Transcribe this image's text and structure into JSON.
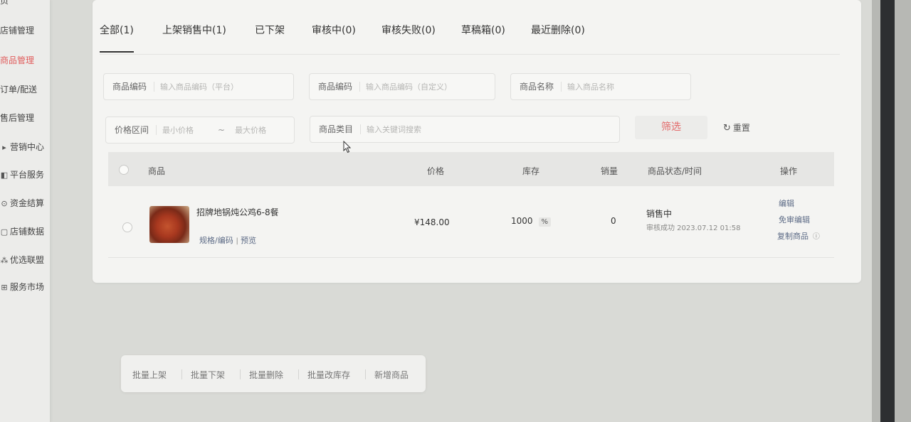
{
  "sidebar": {
    "items": [
      {
        "label": "页",
        "icon": "",
        "active": false
      },
      {
        "label": "店铺管理",
        "icon": "",
        "active": false
      },
      {
        "label": "商品管理",
        "icon": "",
        "active": true
      },
      {
        "label": "订单/配送",
        "icon": "",
        "active": false
      },
      {
        "label": "售后管理",
        "icon": "",
        "active": false
      },
      {
        "label": "营销中心",
        "icon": "megaphone-icon",
        "active": false
      },
      {
        "label": "平台服务",
        "icon": "platform-icon",
        "active": false
      },
      {
        "label": "资金结算",
        "icon": "coin-icon",
        "active": false
      },
      {
        "label": "店铺数据",
        "icon": "chart-icon",
        "active": false
      },
      {
        "label": "优选联盟",
        "icon": "network-icon",
        "active": false
      },
      {
        "label": "服务市场",
        "icon": "market-icon",
        "active": false
      }
    ]
  },
  "tabs": [
    {
      "label": "全部(1)",
      "active": true
    },
    {
      "label": "上架销售中(1)",
      "active": false
    },
    {
      "label": "已下架",
      "active": false
    },
    {
      "label": "审核中(0)",
      "active": false
    },
    {
      "label": "审核失败(0)",
      "active": false
    },
    {
      "label": "草稿箱(0)",
      "active": false
    },
    {
      "label": "最近删除(0)",
      "active": false
    }
  ],
  "filters": {
    "code_platform": {
      "label": "商品编码",
      "placeholder": "输入商品编码（平台）"
    },
    "code_custom": {
      "label": "商品编码",
      "placeholder": "输入商品编码（自定义）"
    },
    "name": {
      "label": "商品名称",
      "placeholder": "输入商品名称"
    },
    "price": {
      "label": "价格区间",
      "min_placeholder": "最小价格",
      "separator": "~",
      "max_placeholder": "最大价格"
    },
    "category": {
      "label": "商品类目",
      "placeholder": "输入关键词搜索"
    },
    "filter_button": "筛选",
    "reset_button": "重置"
  },
  "table": {
    "headers": {
      "product": "商品",
      "price": "价格",
      "stock": "库存",
      "sales": "销量",
      "status": "商品状态/时间",
      "actions": "操作"
    },
    "rows": [
      {
        "name": "招牌地锅炖公鸡6-8餐",
        "sub_link_1": "规格/编码",
        "sub_link_2": "预览",
        "price": "¥148.00",
        "stock": "1000",
        "stock_unit": "%",
        "sales": "0",
        "status": "销售中",
        "status_time": "审核成功 2023.07.12 01:58",
        "actions": [
          "编辑",
          "免审编辑",
          "复制商品"
        ]
      }
    ]
  },
  "batch_actions": [
    "批量上架",
    "批量下架",
    "批量删除",
    "批量改库存",
    "新增商品"
  ],
  "colors": {
    "accent_red": "#e05b5b",
    "link": "#5d6b86"
  }
}
